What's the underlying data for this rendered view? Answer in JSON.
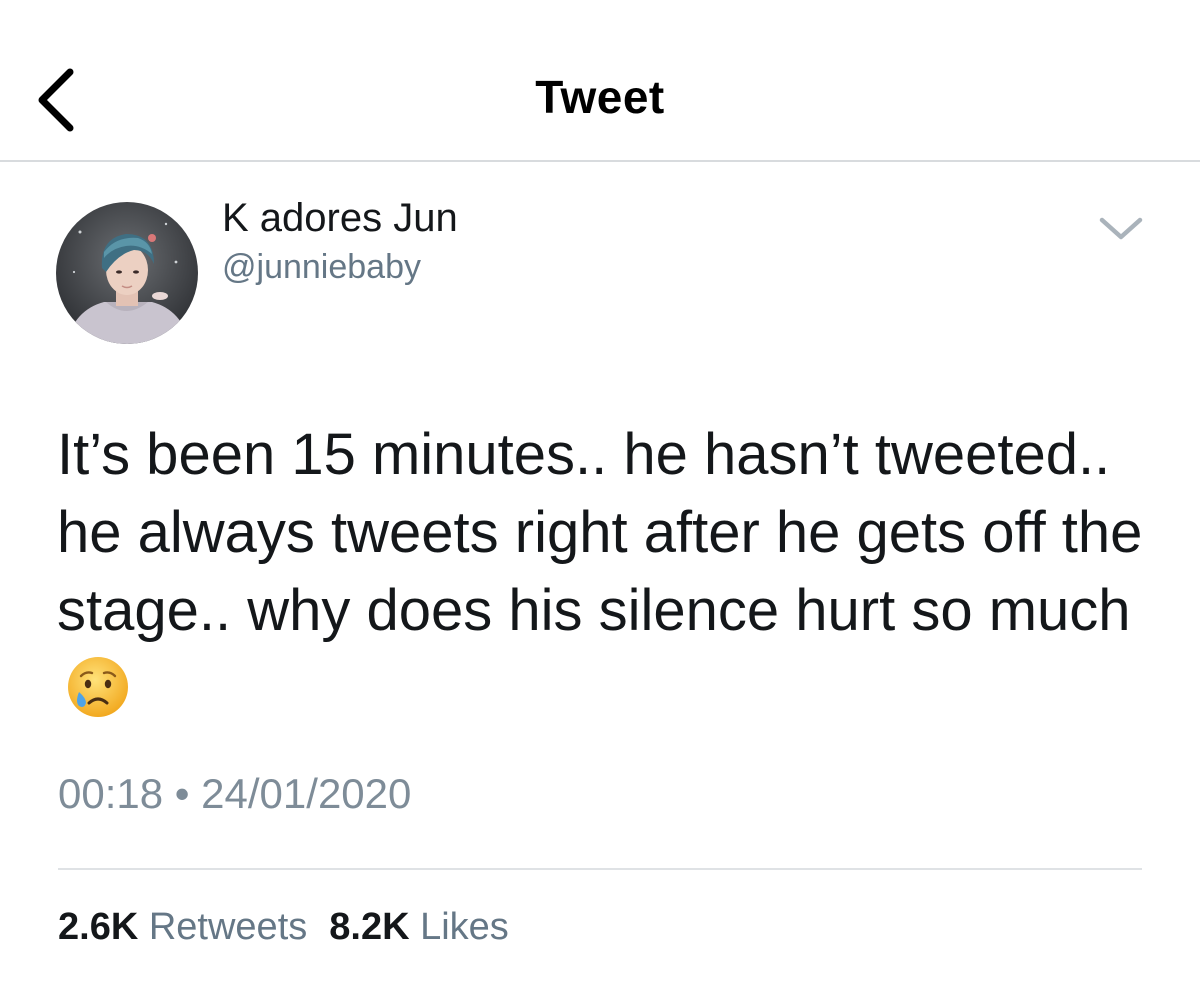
{
  "nav": {
    "title": "Tweet",
    "back_icon": "chevron-left-icon"
  },
  "tweet": {
    "author": {
      "display_name": "K adores Jun",
      "handle": "@junniebaby",
      "avatar_icon": "avatar-photo"
    },
    "more_icon": "chevron-down-icon",
    "text": "It’s been 15 minutes.. he hasn’t tweeted.. he always tweets right after he gets off the stage.. why does his silence hurt so much",
    "emoji": "crying-face-emoji",
    "time": "00:18",
    "separator": "•",
    "date": "24/01/2020"
  },
  "stats": {
    "retweets_count": "2.6K",
    "retweets_label": "Retweets",
    "likes_count": "8.2K",
    "likes_label": "Likes"
  },
  "colors": {
    "text_primary": "#14171a",
    "text_secondary": "#657786",
    "divider": "#d8dbde",
    "emoji_yellow": "#f7c23a",
    "tear_blue": "#4ea3e6"
  }
}
